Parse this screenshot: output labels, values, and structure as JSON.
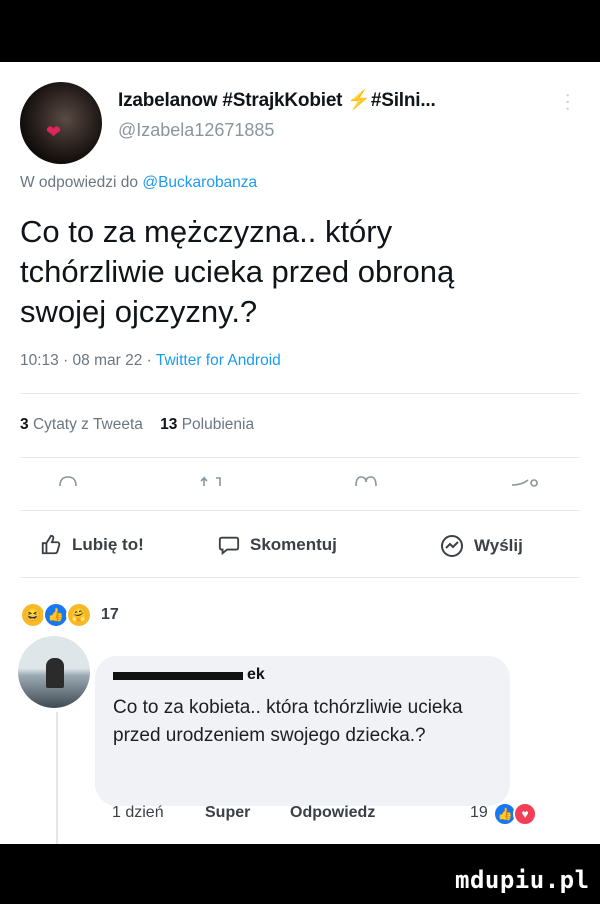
{
  "tweet": {
    "display_name": "Izabelanow #StrajkKobiet ",
    "bolt": "⚡",
    "display_name_tail": "#Silni...",
    "handle": "@Izabela12671885",
    "reply_prefix": "W odpowiedzi do ",
    "reply_mention": "@Buckarobanza",
    "text": "Co to za mężczyzna.. który tchórzliwie ucieka przed obroną swojej ojczyzny.?",
    "timestamp": "10:13 · 08 mar 22 · ",
    "source": "Twitter for Android",
    "quotes_count": "3",
    "quotes_label": "Cytaty z Tweeta",
    "likes_count": "13",
    "likes_label": "Polubienia"
  },
  "facebook": {
    "like_label": "Lubię to!",
    "comment_label": "Skomentuj",
    "share_label": "Wyślij",
    "reaction_count": "17",
    "comment": {
      "author_visible": "ek",
      "text": "Co to za kobieta.. która tchórzliwie ucieka przed urodzeniem swojego dziecka.?",
      "time": "1 dzień",
      "super_label": "Super",
      "reply_label": "Odpowiedz",
      "reaction_count": "19"
    }
  },
  "watermark": "mdupiu.pl",
  "colors": {
    "link": "#1d9bf0",
    "like_blue": "#1877f2",
    "love_red": "#f33e58",
    "haha_yellow": "#f7b928"
  },
  "icons": [
    "heart-icon",
    "more-vertical-icon",
    "reply-icon",
    "retweet-icon",
    "like-outline-icon",
    "share-icon",
    "thumb-up-icon",
    "comment-bubble-icon",
    "messenger-icon"
  ]
}
